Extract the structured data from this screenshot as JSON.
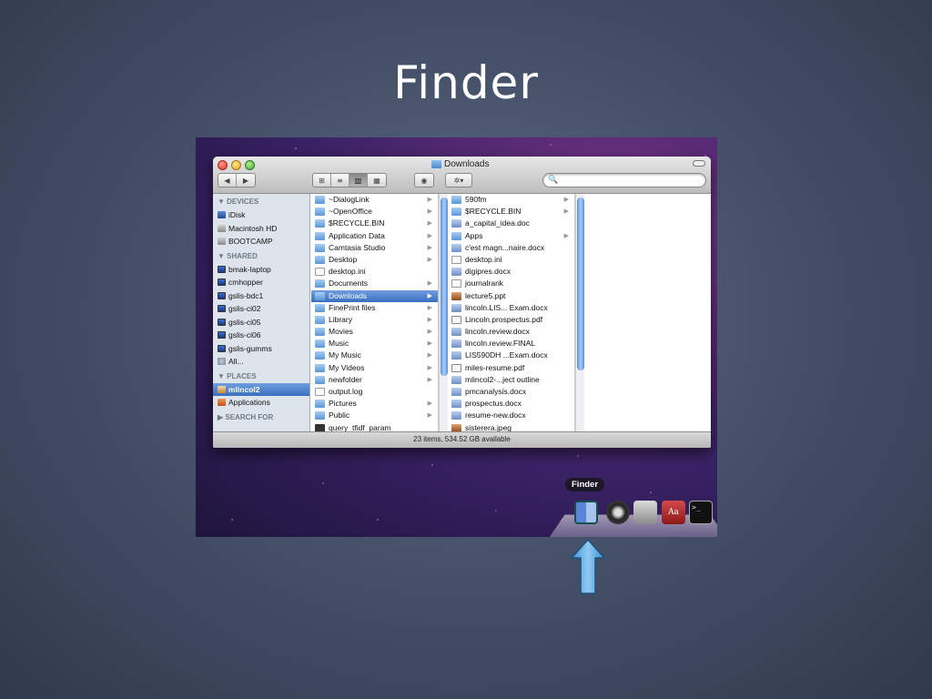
{
  "slide": {
    "title": "Finder"
  },
  "window": {
    "title": "Downloads",
    "toolbar": {
      "back_icon": "◀",
      "forward_icon": "▶",
      "views": [
        "icon-view",
        "list-view",
        "column-view",
        "coverflow-view"
      ],
      "view_glyphs": [
        "⊞",
        "≡",
        "▥",
        "▦"
      ],
      "active_view": "column-view",
      "quicklook_glyph": "◉",
      "action_glyph": "✲▾",
      "search_glyph": "🔍"
    },
    "sidebar": {
      "devices_header": "▼ DEVICES",
      "devices": [
        "iDisk",
        "Macintosh HD",
        "BOOTCAMP"
      ],
      "shared_header": "▼ SHARED",
      "shared": [
        "bmak-laptop",
        "cmhopper",
        "gslis-bdc1",
        "gslis-ci02",
        "gslis-ci05",
        "gslis-ci06",
        "gslis-gumms",
        "All..."
      ],
      "places_header": "▼ PLACES",
      "places": [
        "mlincol2",
        "Applications"
      ],
      "selected": "mlincol2",
      "search_header": "▶ SEARCH FOR"
    },
    "column1": [
      {
        "name": "~DialogLink",
        "arrow": true,
        "type": "folder"
      },
      {
        "name": "~OpenOffice",
        "arrow": true,
        "type": "folder"
      },
      {
        "name": "$RECYCLE.BIN",
        "arrow": true,
        "type": "folder"
      },
      {
        "name": "Application Data",
        "arrow": true,
        "type": "folder"
      },
      {
        "name": "Camtasia Studio",
        "arrow": true,
        "type": "folder"
      },
      {
        "name": "Desktop",
        "arrow": true,
        "type": "folder"
      },
      {
        "name": "desktop.ini",
        "arrow": false,
        "type": "doc"
      },
      {
        "name": "Documents",
        "arrow": true,
        "type": "folder"
      },
      {
        "name": "Downloads",
        "arrow": true,
        "type": "folder",
        "selected": true
      },
      {
        "name": "FinePrint files",
        "arrow": true,
        "type": "folder"
      },
      {
        "name": "Library",
        "arrow": true,
        "type": "folder"
      },
      {
        "name": "Movies",
        "arrow": true,
        "type": "folder"
      },
      {
        "name": "Music",
        "arrow": true,
        "type": "folder"
      },
      {
        "name": "My Music",
        "arrow": true,
        "type": "folder"
      },
      {
        "name": "My Videos",
        "arrow": true,
        "type": "folder"
      },
      {
        "name": "newfolder",
        "arrow": true,
        "type": "folder"
      },
      {
        "name": "output.log",
        "arrow": false,
        "type": "doc"
      },
      {
        "name": "Pictures",
        "arrow": true,
        "type": "folder"
      },
      {
        "name": "Public",
        "arrow": true,
        "type": "folder"
      },
      {
        "name": "query_tfidf_param",
        "arrow": false,
        "type": "term"
      }
    ],
    "column2": [
      {
        "name": "590fm",
        "arrow": true,
        "type": "folder"
      },
      {
        "name": "$RECYCLE.BIN",
        "arrow": true,
        "type": "folder"
      },
      {
        "name": "a_capital_idea.doc",
        "arrow": false,
        "type": "word"
      },
      {
        "name": "Apps",
        "arrow": true,
        "type": "folder"
      },
      {
        "name": "c'est magn...naire.docx",
        "arrow": false,
        "type": "word"
      },
      {
        "name": "desktop.ini",
        "arrow": false,
        "type": "doc"
      },
      {
        "name": "digipres.docx",
        "arrow": false,
        "type": "word"
      },
      {
        "name": "journalrank",
        "arrow": false,
        "type": "doc"
      },
      {
        "name": "lecture5.ppt",
        "arrow": false,
        "type": "img"
      },
      {
        "name": "lincoln.LIS... Exam.docx",
        "arrow": false,
        "type": "word"
      },
      {
        "name": "Lincoln.prospectus.pdf",
        "arrow": false,
        "type": "pdf"
      },
      {
        "name": "lincoln.review.docx",
        "arrow": false,
        "type": "word"
      },
      {
        "name": "lincoln.review.FINAL",
        "arrow": false,
        "type": "word"
      },
      {
        "name": "LIS590DH ...Exam.docx",
        "arrow": false,
        "type": "word"
      },
      {
        "name": "miles-resume.pdf",
        "arrow": false,
        "type": "pdf"
      },
      {
        "name": "mlincol2-...ject outline",
        "arrow": false,
        "type": "word"
      },
      {
        "name": "pmcanalysis.docx",
        "arrow": false,
        "type": "word"
      },
      {
        "name": "prospectus.docx",
        "arrow": false,
        "type": "word"
      },
      {
        "name": "resume-new.docx",
        "arrow": false,
        "type": "word"
      },
      {
        "name": "sisterera.jpeg",
        "arrow": false,
        "type": "img"
      }
    ],
    "status": "23 items, 534.52 GB available"
  },
  "dock": {
    "label": "Finder",
    "items": [
      "finder-icon",
      "clock-icon",
      "system-preferences-icon",
      "dictionary-icon",
      "terminal-icon"
    ],
    "dictionary_glyph": "Aa",
    "terminal_glyph": ">_"
  },
  "colors": {
    "selection": "#3a6fbf",
    "sidebar_bg": "#dde4eb",
    "arrow_fill": "#5aa7e0"
  }
}
